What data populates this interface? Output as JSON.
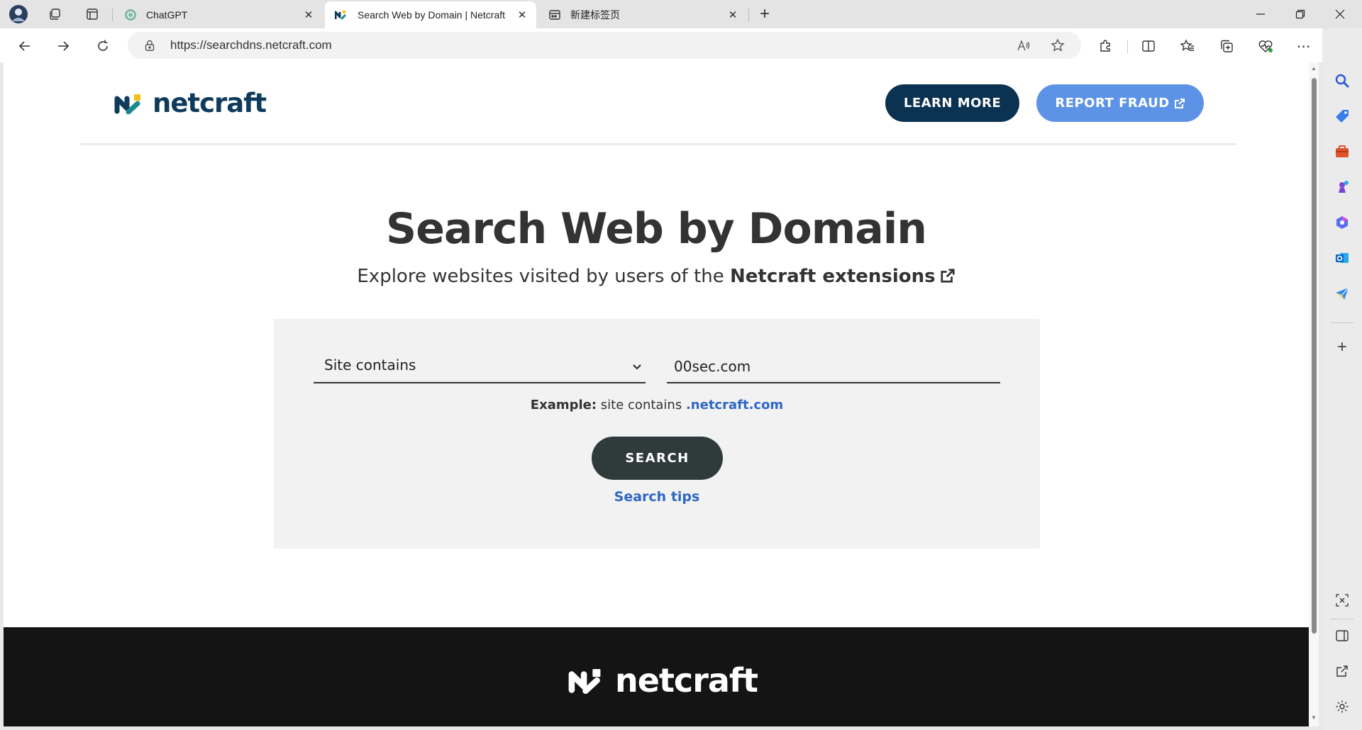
{
  "browser": {
    "tabs": [
      {
        "title": "ChatGPT",
        "active": false
      },
      {
        "title": "Search Web by Domain | Netcraft",
        "active": true
      },
      {
        "title": "新建标签页",
        "active": false
      }
    ],
    "url": "https://searchdns.netcraft.com"
  },
  "page": {
    "brand": "netcraft",
    "header": {
      "learn_more": "LEARN MORE",
      "report_fraud": "REPORT FRAUD"
    },
    "hero": {
      "title": "Search Web by Domain",
      "subtitle_prefix": "Explore websites visited by users of the",
      "subtitle_link": "Netcraft extensions"
    },
    "search": {
      "restriction_selected": "Site contains",
      "query_value": "00sec.com",
      "example_label": "Example:",
      "example_text": "site contains",
      "example_domain": ".netcraft.com",
      "button_label": "SEARCH",
      "tips_link": "Search tips"
    },
    "footer": {
      "brand": "netcraft"
    }
  },
  "colors": {
    "brand_navy": "#0b3250",
    "brand_blue": "#5d93e6",
    "logo_teal": "#1a8a8f",
    "logo_yellow": "#f3c012",
    "link_blue": "#2f67c5",
    "search_button": "#2f3b3b",
    "footer_bg": "#141414"
  },
  "icons": {
    "tab_strip": [
      "profile-avatar-icon",
      "workspaces-icon",
      "vertical-tabs-icon"
    ],
    "toolbar": [
      "back-icon",
      "forward-icon",
      "refresh-icon",
      "lock-icon",
      "read-aloud-icon",
      "favorite-star-icon",
      "extensions-icon",
      "split-screen-icon",
      "favorites-icon",
      "collections-icon",
      "browser-essentials-icon",
      "more-icon",
      "copilot-icon"
    ],
    "sidebar": [
      "search-icon",
      "shopping-icon",
      "tools-icon",
      "games-icon",
      "microsoft365-icon",
      "outlook-icon",
      "send-icon",
      "add-icon",
      "screenshot-icon",
      "sidebar-toggle-icon",
      "open-external-icon",
      "settings-icon"
    ]
  }
}
